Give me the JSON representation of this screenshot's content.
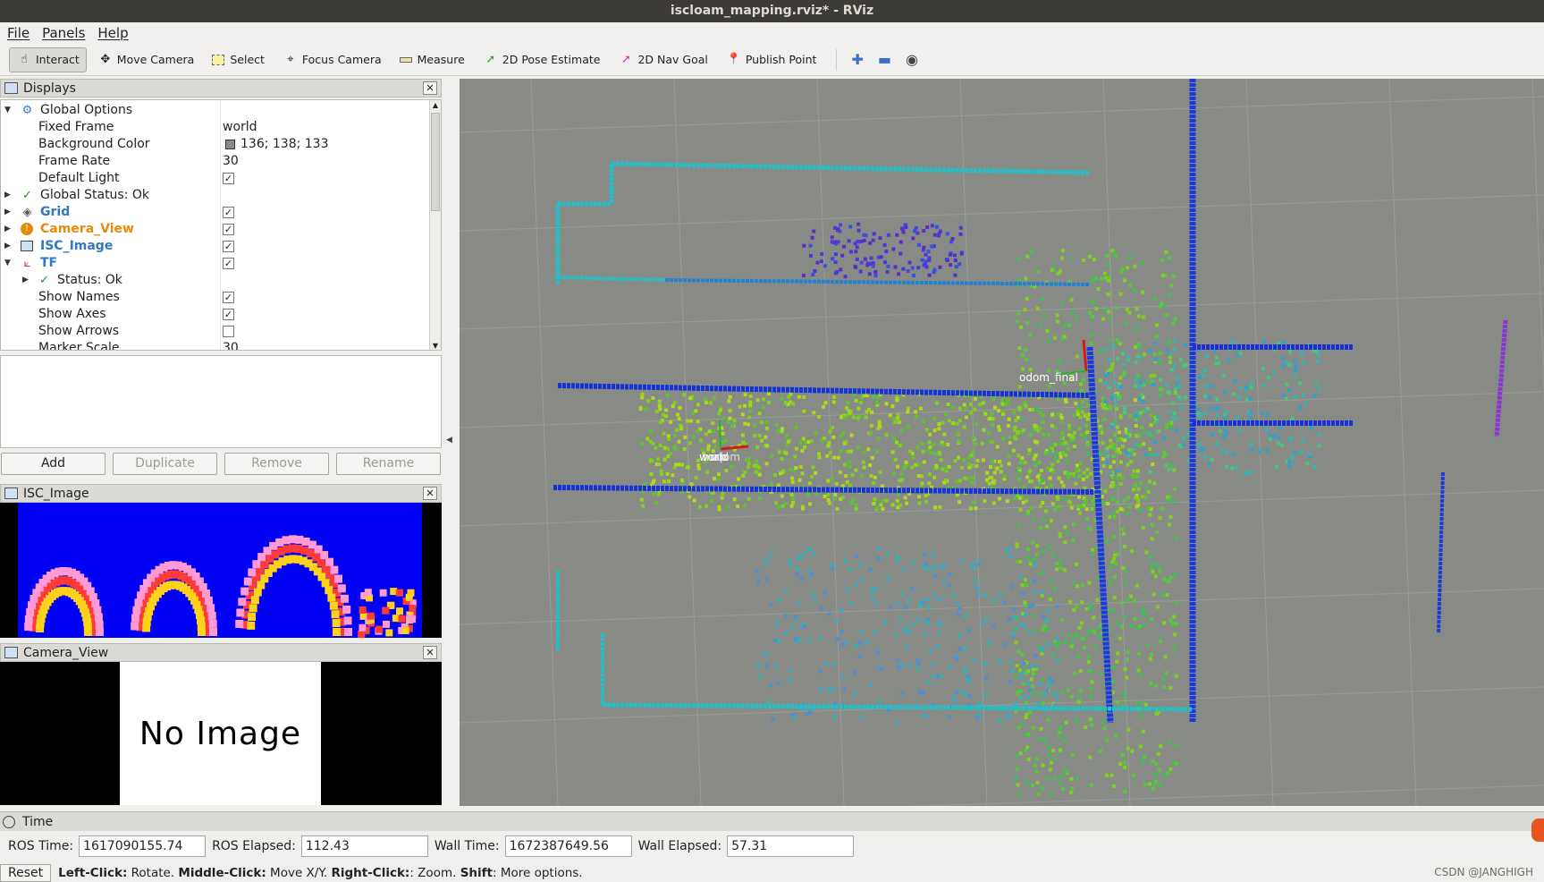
{
  "window": {
    "title": "iscloam_mapping.rviz* - RViz"
  },
  "menu": [
    "File",
    "Panels",
    "Help"
  ],
  "toolbar": {
    "interact": "Interact",
    "move_camera": "Move Camera",
    "select": "Select",
    "focus_camera": "Focus Camera",
    "measure": "Measure",
    "pose_estimate": "2D Pose Estimate",
    "nav_goal": "2D Nav Goal",
    "publish_point": "Publish Point"
  },
  "displays": {
    "title": "Displays",
    "rows": {
      "global_options": "Global Options",
      "fixed_frame_label": "Fixed Frame",
      "fixed_frame_value": "world",
      "bg_color_label": "Background Color",
      "bg_color_value": "136; 138; 133",
      "frame_rate_label": "Frame Rate",
      "frame_rate_value": "30",
      "default_light_label": "Default Light",
      "global_status": "Global Status: Ok",
      "grid": "Grid",
      "camera_view": "Camera_View",
      "isc_image": "ISC_Image",
      "tf": "TF",
      "tf_status": "Status: Ok",
      "show_names": "Show Names",
      "show_axes": "Show Axes",
      "show_arrows": "Show Arrows",
      "marker_scale_label": "Marker Scale",
      "marker_scale_value": "30"
    },
    "checkboxes": {
      "default_light": true,
      "grid": true,
      "camera_view": true,
      "isc_image": true,
      "tf": true,
      "show_names": true,
      "show_axes": true,
      "show_arrows": false
    },
    "buttons": {
      "add": "Add",
      "duplicate": "Duplicate",
      "remove": "Remove",
      "rename": "Rename"
    }
  },
  "isc_panel": {
    "title": "ISC_Image"
  },
  "camera_panel": {
    "title": "Camera_View",
    "no_image": "No Image"
  },
  "map": {
    "background": "#888a85",
    "frames": {
      "odom": "odom_final",
      "world": "world",
      "overlap": "map",
      "overlap_b": "odom"
    }
  },
  "time": {
    "title": "Time",
    "ros_time_label": "ROS Time:",
    "ros_time": "1617090155.74",
    "ros_elapsed_label": "ROS Elapsed:",
    "ros_elapsed": "112.43",
    "wall_time_label": "Wall Time:",
    "wall_time": "1672387649.56",
    "wall_elapsed_label": "Wall Elapsed:",
    "wall_elapsed": "57.31"
  },
  "status": {
    "reset": "Reset",
    "left_click": "Left-Click:",
    "left_click_desc": " Rotate. ",
    "middle_click": "Middle-Click:",
    "middle_click_desc": " Move X/Y. ",
    "right_click": "Right-Click:",
    "right_click_desc": ": Zoom. ",
    "shift": "Shift",
    "shift_desc": ": More options."
  },
  "watermark": "CSDN @JANGHIGH"
}
